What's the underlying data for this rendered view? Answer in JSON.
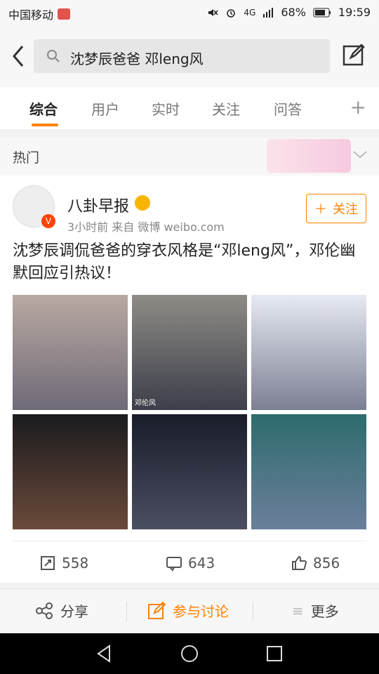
{
  "status_bar": {
    "carrier": "中国移动",
    "battery": "68%",
    "network": "4G",
    "time": "19:59"
  },
  "search": {
    "query": "沈梦辰爸爸 邓leng风"
  },
  "tabs": [
    {
      "label": "综合",
      "active": true
    },
    {
      "label": "用户",
      "active": false
    },
    {
      "label": "实时",
      "active": false
    },
    {
      "label": "关注",
      "active": false
    },
    {
      "label": "问答",
      "active": false
    }
  ],
  "section": {
    "title": "热门"
  },
  "post": {
    "author": "八卦早报",
    "meta": "3小时前  来自 微博 weibo.com",
    "follow_label": "关注",
    "text": "沈梦辰调侃爸爸的穿衣风格是“邓leng风”，邓伦幽默回应引热议！",
    "images": [
      {
        "caption": "",
        "icon": "video-frame"
      },
      {
        "caption": "邓伦风",
        "icon": "video-frame"
      },
      {
        "caption": "",
        "icon": "screenshot"
      },
      {
        "caption": "",
        "icon": "fashion-photo"
      },
      {
        "caption": "",
        "icon": "fashion-photo"
      },
      {
        "caption": "",
        "icon": "fashion-photo"
      }
    ],
    "counts": {
      "reposts": "558",
      "comments": "643",
      "likes": "856"
    }
  },
  "bottom_bar": {
    "share": "分享",
    "discuss": "参与讨论",
    "more": "更多"
  },
  "colors": {
    "accent": "#ff8200",
    "vip": "#ff4400",
    "badge_red": "#e4534b"
  }
}
